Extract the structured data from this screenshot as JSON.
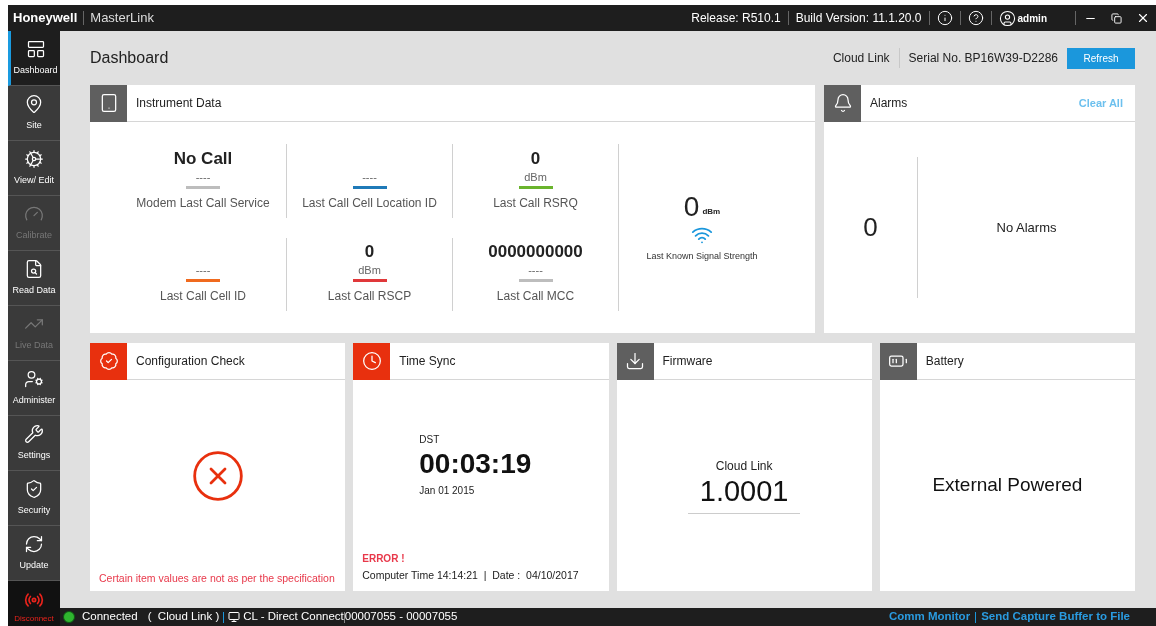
{
  "titlebar": {
    "brand": "Honeywell",
    "app": "MasterLink",
    "release": "Release: R510.1",
    "build": "Build Version: 11.1.20.0",
    "user": "admin"
  },
  "sidebar": {
    "items": [
      {
        "label": "Dashboard",
        "selected": true,
        "disabled": false
      },
      {
        "label": "Site",
        "selected": false,
        "disabled": false
      },
      {
        "label": "View/ Edit",
        "selected": false,
        "disabled": false
      },
      {
        "label": "Calibrate",
        "selected": false,
        "disabled": true
      },
      {
        "label": "Read Data",
        "selected": false,
        "disabled": false
      },
      {
        "label": "Live Data",
        "selected": false,
        "disabled": true
      },
      {
        "label": "Administer",
        "selected": false,
        "disabled": false
      },
      {
        "label": "Settings",
        "selected": false,
        "disabled": false
      },
      {
        "label": "Security",
        "selected": false,
        "disabled": false
      },
      {
        "label": "Update",
        "selected": false,
        "disabled": false
      }
    ],
    "disconnect": "Disconnect"
  },
  "header": {
    "title": "Dashboard",
    "device": "Cloud Link",
    "serial": "Serial No. BP16W39-D2286",
    "refresh": "Refresh"
  },
  "instrument": {
    "title": "Instrument Data",
    "metrics": [
      {
        "value": "No Call",
        "unit": "----",
        "label": "Modem Last Call Service",
        "color": "#bdbdbd"
      },
      {
        "unit": "----",
        "label": "Last Call Cell Location ID",
        "color": "#1f7ab8"
      },
      {
        "value": "0",
        "unit": "dBm",
        "label": "Last Call RSRQ",
        "color": "#6ab42d"
      },
      {
        "unit": "----",
        "label": "Last Call Cell ID",
        "color": "#f06a1e"
      },
      {
        "value": "0",
        "unit": "dBm",
        "label": "Last Call RSCP",
        "color": "#e0383a"
      },
      {
        "value": "0000000000",
        "unit": "----",
        "label": "Last Call MCC",
        "color": "#bdbdbd"
      }
    ],
    "signal": {
      "value": "0",
      "unit": "dBm",
      "label": "Last Known Signal Strength"
    }
  },
  "alarms": {
    "title": "Alarms",
    "clear": "Clear All",
    "count": "0",
    "message": "No Alarms"
  },
  "config": {
    "title": "Configuration Check",
    "alert": true,
    "message": "Certain item values are not as per the specification"
  },
  "timesync": {
    "title": "Time Sync",
    "alert": true,
    "dst": "DST",
    "time": "00:03:19",
    "date": "Jan 01 2015",
    "error": "ERROR !",
    "computer_time": "Computer Time 14:14:21  |  Date :  04/10/2017"
  },
  "firmware": {
    "title": "Firmware",
    "alert": false,
    "label": "Cloud Link",
    "version": "1.0001"
  },
  "battery": {
    "title": "Battery",
    "alert": false,
    "text": "External Powered"
  },
  "status_bar": {
    "connected": true,
    "state": "Connected",
    "link": "(  Cloud Link )",
    "device": "CL - Direct Connect",
    "id": "00007055 - 00007055",
    "links": [
      "Comm Monitor",
      "Send Capture Buffer to File"
    ]
  }
}
